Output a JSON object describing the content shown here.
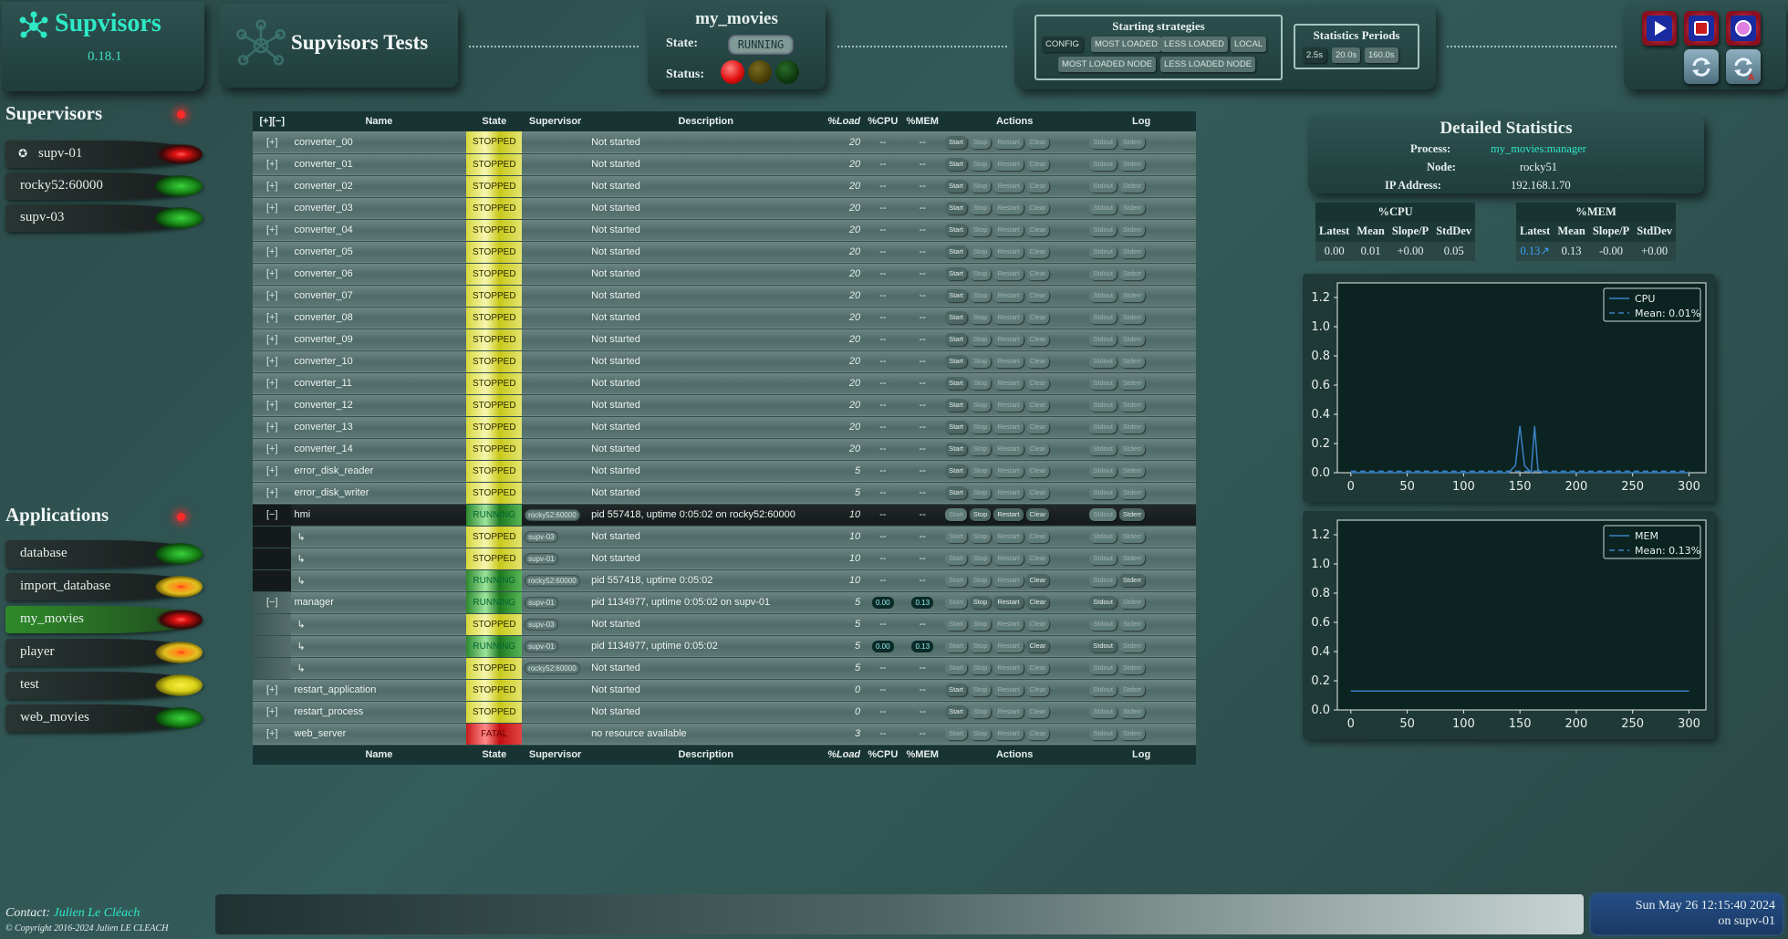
{
  "brand": {
    "title": "Supvisors",
    "version": "0.18.1"
  },
  "header": {
    "tests_title": "Supvisors Tests"
  },
  "application": {
    "name": "my_movies",
    "state_label": "State:",
    "state": "RUNNING",
    "status_label": "Status:"
  },
  "strategies": {
    "title": "Starting strategies",
    "options": [
      "CONFIG",
      "MOST LOADED",
      "LESS LOADED",
      "LOCAL",
      "MOST LOADED NODE",
      "LESS LOADED NODE"
    ],
    "selected": "CONFIG"
  },
  "periods": {
    "title": "Statistics Periods",
    "options": [
      "2.5s",
      "20.0s",
      "160.0s"
    ],
    "selected": "2.5s"
  },
  "controls": {
    "icons": [
      "restart-icon",
      "shutdown-icon",
      "restart-sequence-icon",
      "refresh-icon",
      "auto-refresh-icon"
    ]
  },
  "supervisors": {
    "title": "Supervisors",
    "items": [
      {
        "name": "supv-01",
        "status": "red",
        "local": true
      },
      {
        "name": "rocky52:60000",
        "status": "green"
      },
      {
        "name": "supv-03",
        "status": "green"
      }
    ]
  },
  "applications": {
    "title": "Applications",
    "items": [
      {
        "name": "database",
        "status": "green"
      },
      {
        "name": "import_database",
        "status": "orange"
      },
      {
        "name": "my_movies",
        "status": "red",
        "selected": true
      },
      {
        "name": "player",
        "status": "orange"
      },
      {
        "name": "test",
        "status": "yellow"
      },
      {
        "name": "web_movies",
        "status": "green"
      }
    ]
  },
  "table": {
    "expand_all": "[+]",
    "collapse_all": "[−]",
    "headers": [
      "Name",
      "State",
      "Supervisor",
      "Description",
      "%Load",
      "%CPU",
      "%MEM",
      "Actions",
      "Log"
    ],
    "action_labels": [
      "Start",
      "Stop",
      "Restart",
      "Clear",
      "Stdout",
      "Stderr"
    ],
    "rows": [
      {
        "exp": "[+]",
        "name": "converter_00",
        "state": "STOPPED",
        "sup": "",
        "desc": "Not started",
        "load": "20",
        "cpu": "--",
        "mem": "--",
        "en": [
          0
        ]
      },
      {
        "exp": "[+]",
        "name": "converter_01",
        "state": "STOPPED",
        "sup": "",
        "desc": "Not started",
        "load": "20",
        "cpu": "--",
        "mem": "--",
        "en": [
          0
        ]
      },
      {
        "exp": "[+]",
        "name": "converter_02",
        "state": "STOPPED",
        "sup": "",
        "desc": "Not started",
        "load": "20",
        "cpu": "--",
        "mem": "--",
        "en": [
          0
        ]
      },
      {
        "exp": "[+]",
        "name": "converter_03",
        "state": "STOPPED",
        "sup": "",
        "desc": "Not started",
        "load": "20",
        "cpu": "--",
        "mem": "--",
        "en": [
          0
        ]
      },
      {
        "exp": "[+]",
        "name": "converter_04",
        "state": "STOPPED",
        "sup": "",
        "desc": "Not started",
        "load": "20",
        "cpu": "--",
        "mem": "--",
        "en": [
          0
        ]
      },
      {
        "exp": "[+]",
        "name": "converter_05",
        "state": "STOPPED",
        "sup": "",
        "desc": "Not started",
        "load": "20",
        "cpu": "--",
        "mem": "--",
        "en": [
          0
        ]
      },
      {
        "exp": "[+]",
        "name": "converter_06",
        "state": "STOPPED",
        "sup": "",
        "desc": "Not started",
        "load": "20",
        "cpu": "--",
        "mem": "--",
        "en": [
          0
        ]
      },
      {
        "exp": "[+]",
        "name": "converter_07",
        "state": "STOPPED",
        "sup": "",
        "desc": "Not started",
        "load": "20",
        "cpu": "--",
        "mem": "--",
        "en": [
          0
        ]
      },
      {
        "exp": "[+]",
        "name": "converter_08",
        "state": "STOPPED",
        "sup": "",
        "desc": "Not started",
        "load": "20",
        "cpu": "--",
        "mem": "--",
        "en": [
          0
        ]
      },
      {
        "exp": "[+]",
        "name": "converter_09",
        "state": "STOPPED",
        "sup": "",
        "desc": "Not started",
        "load": "20",
        "cpu": "--",
        "mem": "--",
        "en": [
          0
        ]
      },
      {
        "exp": "[+]",
        "name": "converter_10",
        "state": "STOPPED",
        "sup": "",
        "desc": "Not started",
        "load": "20",
        "cpu": "--",
        "mem": "--",
        "en": [
          0
        ]
      },
      {
        "exp": "[+]",
        "name": "converter_11",
        "state": "STOPPED",
        "sup": "",
        "desc": "Not started",
        "load": "20",
        "cpu": "--",
        "mem": "--",
        "en": [
          0
        ]
      },
      {
        "exp": "[+]",
        "name": "converter_12",
        "state": "STOPPED",
        "sup": "",
        "desc": "Not started",
        "load": "20",
        "cpu": "--",
        "mem": "--",
        "en": [
          0
        ]
      },
      {
        "exp": "[+]",
        "name": "converter_13",
        "state": "STOPPED",
        "sup": "",
        "desc": "Not started",
        "load": "20",
        "cpu": "--",
        "mem": "--",
        "en": [
          0
        ]
      },
      {
        "exp": "[+]",
        "name": "converter_14",
        "state": "STOPPED",
        "sup": "",
        "desc": "Not started",
        "load": "20",
        "cpu": "--",
        "mem": "--",
        "en": [
          0
        ]
      },
      {
        "exp": "[+]",
        "name": "error_disk_reader",
        "state": "STOPPED",
        "sup": "",
        "desc": "Not started",
        "load": "5",
        "cpu": "--",
        "mem": "--",
        "en": [
          0
        ]
      },
      {
        "exp": "[+]",
        "name": "error_disk_writer",
        "state": "STOPPED",
        "sup": "",
        "desc": "Not started",
        "load": "5",
        "cpu": "--",
        "mem": "--",
        "en": [
          0
        ]
      },
      {
        "exp": "[−]",
        "name": "hmi",
        "state": "RUNNING",
        "sup": "rocky52:60000",
        "desc": "pid 557418, uptime 0:05:02 on rocky52:60000",
        "load": "10",
        "cpu": "--",
        "mem": "--",
        "en": [
          1,
          2,
          3,
          5
        ],
        "dark": true
      },
      {
        "exp": "",
        "name": "↳",
        "state": "STOPPED",
        "sup": "supv-03",
        "desc": "Not started",
        "load": "10",
        "cpu": "--",
        "mem": "--",
        "en": [],
        "sub": true
      },
      {
        "exp": "",
        "name": "↳",
        "state": "STOPPED",
        "sup": "supv-01",
        "desc": "Not started",
        "load": "10",
        "cpu": "--",
        "mem": "--",
        "en": [],
        "sub": true
      },
      {
        "exp": "",
        "name": "↳",
        "state": "RUNNING",
        "sup": "rocky52:60000",
        "desc": "pid 557418, uptime 0:05:02",
        "load": "10",
        "cpu": "--",
        "mem": "--",
        "en": [
          3,
          5
        ],
        "sub": true
      },
      {
        "exp": "[−]",
        "name": "manager",
        "state": "RUNNING",
        "sup": "supv-01",
        "desc": "pid 1134977, uptime 0:05:02 on supv-01",
        "load": "5",
        "cpu": "0.00",
        "mem": "0.13",
        "en": [
          1,
          2,
          3,
          4
        ],
        "m": true
      },
      {
        "exp": "",
        "name": "↳",
        "state": "STOPPED",
        "sup": "supv-03",
        "desc": "Not started",
        "load": "5",
        "cpu": "--",
        "mem": "--",
        "en": [],
        "sub": true,
        "m": true
      },
      {
        "exp": "",
        "name": "↳",
        "state": "RUNNING",
        "sup": "supv-01",
        "desc": "pid 1134977, uptime 0:05:02",
        "load": "5",
        "cpu": "0.00",
        "mem": "0.13",
        "en": [
          3,
          4
        ],
        "sub": true,
        "m": true
      },
      {
        "exp": "",
        "name": "↳",
        "state": "STOPPED",
        "sup": "rocky52:60000",
        "desc": "Not started",
        "load": "5",
        "cpu": "--",
        "mem": "--",
        "en": [],
        "sub": true,
        "m": true
      },
      {
        "exp": "[+]",
        "name": "restart_application",
        "state": "STOPPED",
        "sup": "",
        "desc": "Not started",
        "load": "0",
        "cpu": "--",
        "mem": "--",
        "en": [
          0
        ]
      },
      {
        "exp": "[+]",
        "name": "restart_process",
        "state": "STOPPED",
        "sup": "",
        "desc": "Not started",
        "load": "0",
        "cpu": "--",
        "mem": "--",
        "en": [
          0
        ]
      },
      {
        "exp": "[+]",
        "name": "web_server",
        "state": "FATAL",
        "sup": "",
        "desc": "no resource available",
        "load": "3",
        "cpu": "--",
        "mem": "--",
        "en": []
      }
    ]
  },
  "details": {
    "title": "Detailed Statistics",
    "process_label": "Process:",
    "process": "my_movies:manager",
    "node_label": "Node:",
    "node": "rocky51",
    "ip_label": "IP Address:",
    "ip": "192.168.1.70"
  },
  "cpu_stats": {
    "title": "%CPU",
    "headers": [
      "Latest",
      "Mean",
      "Slope/P",
      "StdDev"
    ],
    "values": [
      "0.00",
      "0.01",
      "+0.00",
      "0.05"
    ]
  },
  "mem_stats": {
    "title": "%MEM",
    "headers": [
      "Latest",
      "Mean",
      "Slope/P",
      "StdDev"
    ],
    "values": [
      "0.13↗",
      "0.13",
      "-0.00",
      "+0.00"
    ]
  },
  "chart_data": [
    {
      "type": "line",
      "series": [
        {
          "name": "CPU",
          "x": [
            0,
            140,
            146,
            150,
            154,
            160,
            163,
            166,
            170,
            300
          ],
          "y": [
            0.0,
            0.0,
            0.05,
            0.32,
            0.05,
            0.0,
            0.32,
            0.02,
            0.0,
            0.0
          ]
        },
        {
          "name": "Mean: 0.01%",
          "x": [
            0,
            300
          ],
          "y": [
            0.01,
            0.01
          ],
          "dashed": true
        }
      ],
      "xlim": [
        -12,
        315
      ],
      "ylim": [
        0,
        1.3
      ],
      "xticks": [
        0,
        50,
        100,
        150,
        200,
        250,
        300
      ],
      "yticks": [
        0.0,
        0.2,
        0.4,
        0.6,
        0.8,
        1.0,
        1.2
      ],
      "legend": "top-right"
    },
    {
      "type": "line",
      "series": [
        {
          "name": "MEM",
          "x": [
            0,
            300
          ],
          "y": [
            0.13,
            0.13
          ]
        },
        {
          "name": "Mean: 0.13%",
          "x": [
            0,
            300
          ],
          "y": [
            0.13,
            0.13
          ],
          "dashed": true
        }
      ],
      "xlim": [
        -12,
        315
      ],
      "ylim": [
        0,
        1.3
      ],
      "xticks": [
        0,
        50,
        100,
        150,
        200,
        250,
        300
      ],
      "yticks": [
        0.0,
        0.2,
        0.4,
        0.6,
        0.8,
        1.0,
        1.2
      ],
      "legend": "top-right"
    }
  ],
  "footer": {
    "contact_label": "Contact:",
    "contact_name": "Julien Le Cléach",
    "copyright": "© Copyright 2016-2024 Julien LE CLEACH",
    "clock": "Sun May 26 12:15:40 2024",
    "clock_node": "on supv-01"
  },
  "colors": {
    "accent": "#2ee8c6",
    "stopped": "#d6d63a",
    "running": "#2c8a2c",
    "fatal": "#c81a1a"
  }
}
